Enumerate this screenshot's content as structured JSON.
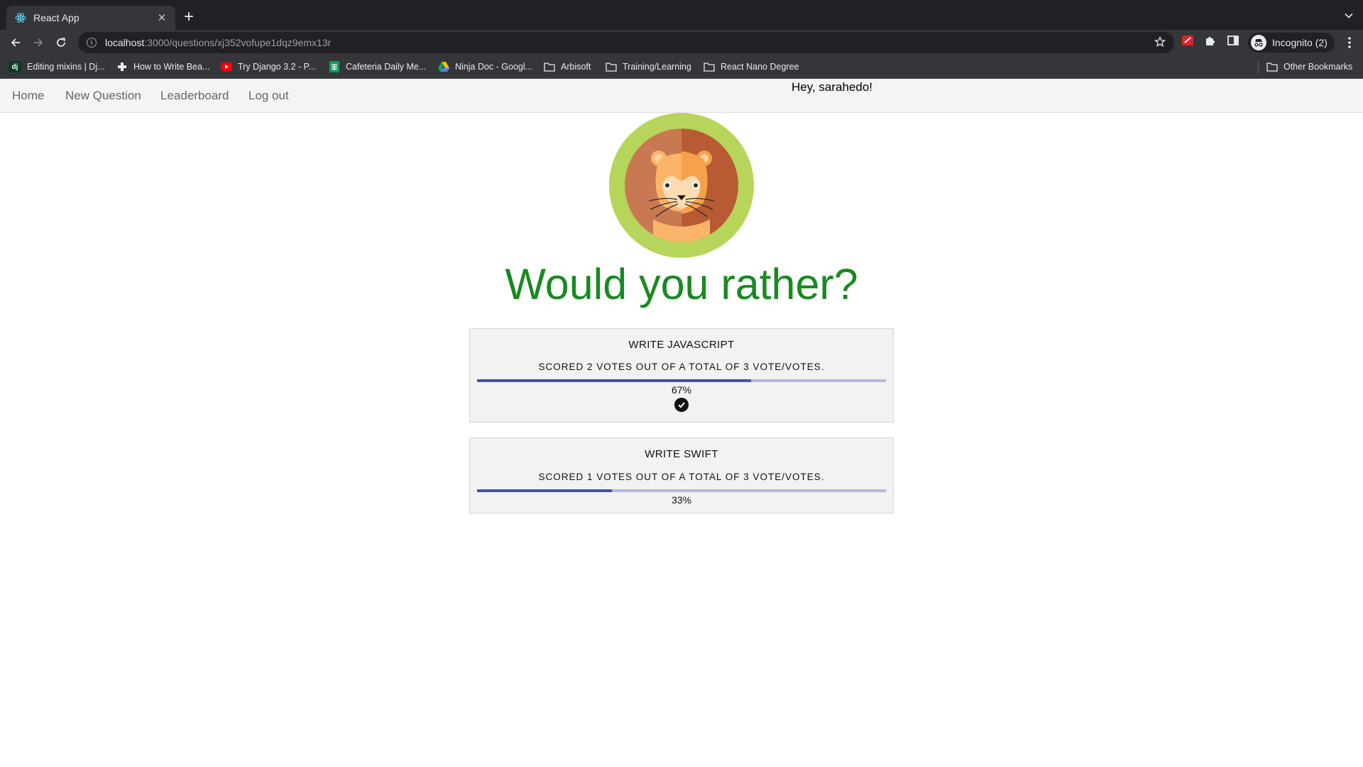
{
  "browser": {
    "tab_title": "React App",
    "url_host": "localhost",
    "url_rest": ":3000/questions/xj352vofupe1dqz9emx13r",
    "profile_label": "Incognito (2)",
    "bookmarks": [
      {
        "label": "Editing mixins | Dj...",
        "icon": "django-icon"
      },
      {
        "label": "How to Write Bea...",
        "icon": "medical-cross-icon"
      },
      {
        "label": "Try Django 3.2 - P...",
        "icon": "youtube-icon"
      },
      {
        "label": "Cafeteria Daily Me...",
        "icon": "sheets-icon"
      },
      {
        "label": "Ninja Doc - Googl...",
        "icon": "drive-icon"
      },
      {
        "label": "Arbisoft",
        "icon": "folder-icon"
      },
      {
        "label": "Training/Learning",
        "icon": "folder-icon"
      },
      {
        "label": "React Nano Degree",
        "icon": "folder-icon"
      }
    ],
    "other_bookmarks": "Other Bookmarks"
  },
  "nav": {
    "home": "Home",
    "new_question": "New Question",
    "leaderboard": "Leaderboard",
    "logout": "Log out",
    "greeting": "Hey, sarahedo!"
  },
  "question": {
    "title": "Would you rather?",
    "options": [
      {
        "text": "WRITE JAVASCRIPT",
        "score": "SCORED 2 VOTES OUT OF A TOTAL OF 3 VOTE/VOTES.",
        "percent_label": "67%",
        "percent": 0.67,
        "selected": true
      },
      {
        "text": "WRITE SWIFT",
        "score": "SCORED 1 VOTES OUT OF A TOTAL OF 3 VOTE/VOTES.",
        "percent_label": "33%",
        "percent": 0.33,
        "selected": false
      }
    ]
  },
  "colors": {
    "title_green": "#188a20",
    "bar_fill": "#3f51b5",
    "bar_track": "#b3b8e0",
    "card_bg": "#f2f2f2",
    "nav_bg": "#f4f4f4"
  }
}
